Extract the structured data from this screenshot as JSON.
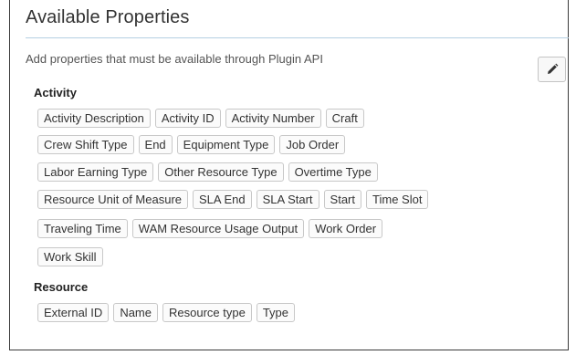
{
  "panel": {
    "title": "Available Properties",
    "description": "Add properties that must be available through Plugin API",
    "edit_icon": "pencil-icon"
  },
  "sections": [
    {
      "title": "Activity",
      "rows": [
        [
          "Activity Description",
          "Activity ID",
          "Activity Number",
          "Craft"
        ],
        [
          "Crew Shift Type",
          "End",
          "Equipment Type",
          "Job Order"
        ],
        [
          "Labor Earning Type",
          "Other Resource Type",
          "Overtime Type"
        ],
        [
          "Resource Unit of Measure",
          "SLA End",
          "SLA Start",
          "Start",
          "Time Slot"
        ],
        [
          "Traveling Time",
          "WAM Resource Usage Output",
          "Work Order"
        ],
        [
          "Work Skill"
        ]
      ]
    },
    {
      "title": "Resource",
      "rows": [
        [
          "External ID",
          "Name",
          "Resource type",
          "Type"
        ]
      ]
    }
  ]
}
